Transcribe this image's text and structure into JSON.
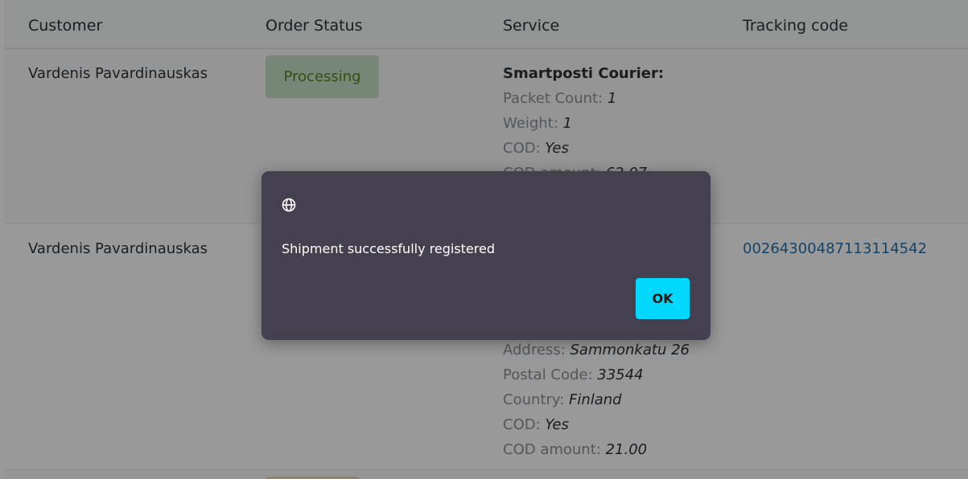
{
  "table": {
    "headers": {
      "customer": "Customer",
      "order_status": "Order Status",
      "service": "Service",
      "tracking": "Tracking code"
    },
    "rows": [
      {
        "customer": "Vardenis Pavardinauskas",
        "status": "Processing",
        "service_title": "Smartposti Courier:",
        "fields": [
          {
            "label": "Packet Count: ",
            "value": "1"
          },
          {
            "label": "Weight: ",
            "value": "1"
          },
          {
            "label": "COD: ",
            "value": "Yes"
          },
          {
            "label": "COD amount: ",
            "value": "62.07"
          }
        ],
        "tracking": ""
      },
      {
        "customer": "Vardenis Pavardinauskas",
        "fields": [
          {
            "label": "Address: ",
            "value": "Sammonkatu 26"
          },
          {
            "label": "Postal Code: ",
            "value": "33544"
          },
          {
            "label": "Country: ",
            "value": "Finland"
          },
          {
            "label": "COD: ",
            "value": "Yes"
          },
          {
            "label": "COD amount: ",
            "value": "21.00"
          }
        ],
        "tracking": "00264300487113114542"
      }
    ]
  },
  "dialog": {
    "icon": "globe-icon",
    "message": "Shipment successfully registered",
    "ok_label": "OK"
  },
  "colors": {
    "dialog_bg": "#44404f",
    "ok_button": "#00d8ff",
    "status_processing_bg": "#c6e1c6",
    "status_processing_text": "#5b841b",
    "link": "#2271b1"
  }
}
